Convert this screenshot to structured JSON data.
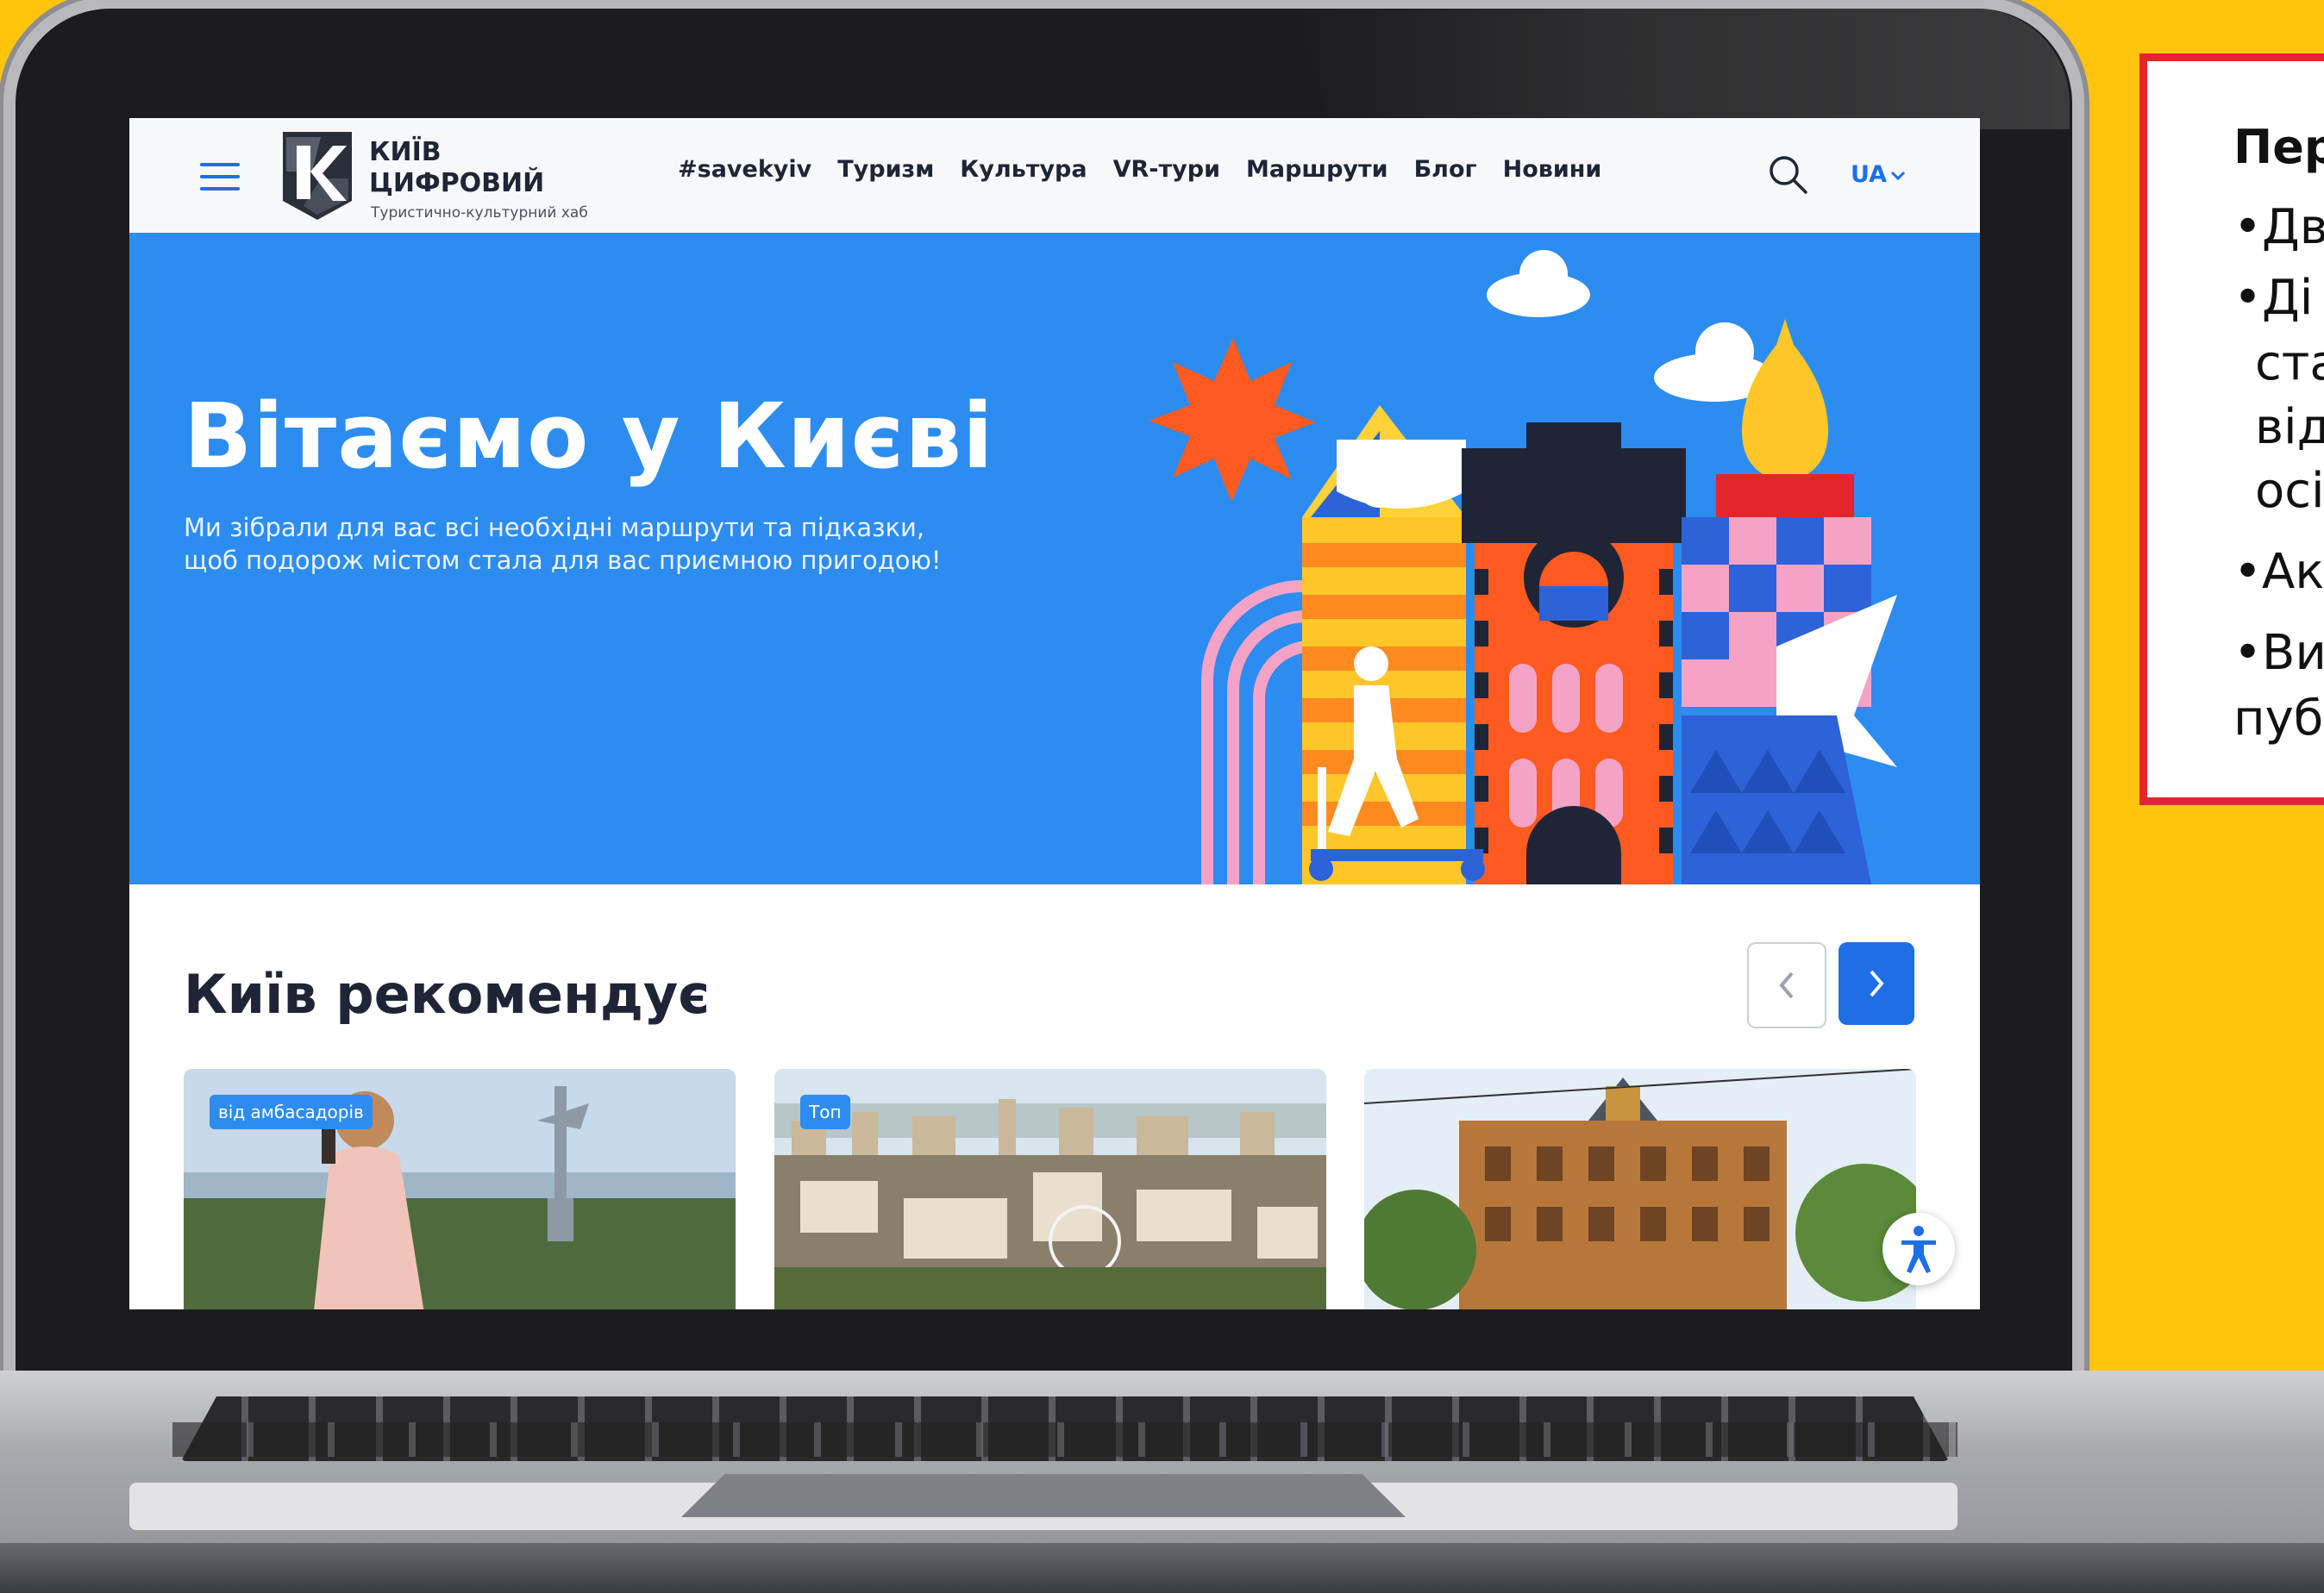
{
  "site": {
    "logo_title_line1": "КИЇВ",
    "logo_title_line2": "ЦИФРОВИЙ",
    "logo_subtitle": "Туристично-культурний хаб",
    "nav": [
      "#savekyiv",
      "Туризм",
      "Культура",
      "VR-тури",
      "Маршрути",
      "Блог",
      "Новини"
    ],
    "language": "UA"
  },
  "hero": {
    "title": "Вітаємо у Києві",
    "subtitle": "Ми зібрали для вас всі необхідні маршрути та підказки, щоб подорож містом стала для вас приємною пригодою!"
  },
  "recommend": {
    "title": "Київ рекомендує",
    "cards": [
      {
        "badge": "від амбасадорів"
      },
      {
        "badge": "Топ"
      },
      {
        "badge": ""
      }
    ]
  },
  "side_panel": {
    "title": "Пер",
    "lines": [
      "•Дв",
      "•Дi",
      "ста",
      "вiд",
      "осi",
      "•Ак",
      "•Ви",
      "пуб"
    ]
  },
  "colors": {
    "background": "#FFC40C",
    "hero_blue": "#2d8cf0",
    "accent_blue": "#1e6fe6",
    "panel_border": "#e3262b"
  },
  "icons": {
    "menu": "hamburger-menu-icon",
    "search": "search-icon",
    "language_dropdown": "chevron-down-icon",
    "prev": "chevron-left-icon",
    "next": "chevron-right-icon",
    "accessibility": "accessibility-icon"
  }
}
